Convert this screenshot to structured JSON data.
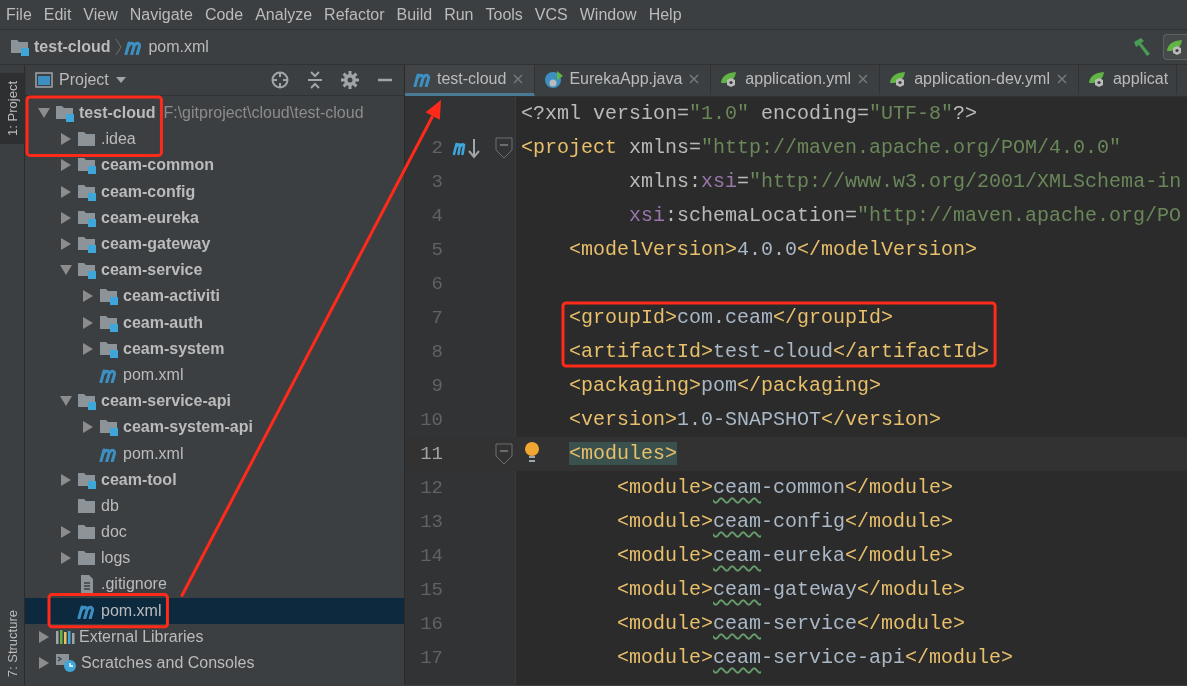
{
  "menu": [
    "File",
    "Edit",
    "View",
    "Navigate",
    "Code",
    "Analyze",
    "Refactor",
    "Build",
    "Run",
    "Tools",
    "VCS",
    "Window",
    "Help"
  ],
  "breadcrumb": [
    {
      "label": "test-cloud",
      "kind": "module",
      "bold": true
    },
    {
      "label": "pom.xml",
      "kind": "maven",
      "bold": false
    }
  ],
  "side_tabs": [
    {
      "label": "1: Project",
      "selected": true
    },
    {
      "label": "7: Structure",
      "selected": false
    }
  ],
  "project_panel": {
    "title": "Project",
    "tree": [
      {
        "label": "test-cloud",
        "hint": "F:\\gitproject\\cloud\\test-cloud",
        "kind": "module",
        "bold": true,
        "expanded": true,
        "selected": false,
        "boxed": true,
        "children": [
          {
            "label": ".idea",
            "kind": "folder",
            "bold": false,
            "expanded": false,
            "selected": false,
            "boxed": true
          },
          {
            "label": "ceam-common",
            "kind": "module",
            "bold": true,
            "expanded": false,
            "selected": false,
            "boxed": false
          },
          {
            "label": "ceam-config",
            "kind": "module",
            "bold": true,
            "expanded": false,
            "selected": false,
            "boxed": false
          },
          {
            "label": "ceam-eureka",
            "kind": "module",
            "bold": true,
            "expanded": false,
            "selected": false,
            "boxed": false
          },
          {
            "label": "ceam-gateway",
            "kind": "module",
            "bold": true,
            "expanded": false,
            "selected": false,
            "boxed": false
          },
          {
            "label": "ceam-service",
            "kind": "module",
            "bold": true,
            "expanded": true,
            "selected": false,
            "boxed": false,
            "children": [
              {
                "label": "ceam-activiti",
                "kind": "module",
                "bold": true,
                "expanded": false,
                "selected": false,
                "boxed": false
              },
              {
                "label": "ceam-auth",
                "kind": "module",
                "bold": true,
                "expanded": false,
                "selected": false,
                "boxed": false
              },
              {
                "label": "ceam-system",
                "kind": "module",
                "bold": true,
                "expanded": false,
                "selected": false,
                "boxed": false
              },
              {
                "label": "pom.xml",
                "kind": "maven",
                "bold": false,
                "selected": false,
                "boxed": false
              }
            ]
          },
          {
            "label": "ceam-service-api",
            "kind": "module",
            "bold": true,
            "expanded": true,
            "selected": false,
            "boxed": false,
            "children": [
              {
                "label": "ceam-system-api",
                "kind": "module",
                "bold": true,
                "expanded": false,
                "selected": false,
                "boxed": false
              },
              {
                "label": "pom.xml",
                "kind": "maven",
                "bold": false,
                "selected": false,
                "boxed": false
              }
            ]
          },
          {
            "label": "ceam-tool",
            "kind": "module",
            "bold": true,
            "expanded": false,
            "selected": false,
            "boxed": false
          },
          {
            "label": "db",
            "kind": "folder",
            "bold": false,
            "selected": false,
            "boxed": false
          },
          {
            "label": "doc",
            "kind": "folder",
            "bold": false,
            "expanded": false,
            "selected": false,
            "boxed": false
          },
          {
            "label": "logs",
            "kind": "folder",
            "bold": false,
            "expanded": false,
            "selected": false,
            "boxed": false
          },
          {
            "label": ".gitignore",
            "kind": "file",
            "bold": false,
            "selected": false,
            "boxed": false
          },
          {
            "label": "pom.xml",
            "kind": "maven",
            "bold": false,
            "selected": true,
            "boxed": true
          }
        ]
      },
      {
        "label": "External Libraries",
        "kind": "libraries",
        "bold": false,
        "expanded": false,
        "selected": false,
        "boxed": false
      },
      {
        "label": "Scratches and Consoles",
        "kind": "scratches",
        "bold": false,
        "expanded": false,
        "selected": false,
        "boxed": false
      }
    ]
  },
  "editor": {
    "tabs": [
      {
        "label": "test-cloud",
        "kind": "maven",
        "selected": true,
        "closable": true,
        "arrow_to": true
      },
      {
        "label": "EurekaApp.java",
        "kind": "class",
        "selected": false,
        "closable": true,
        "arrow_to": false
      },
      {
        "label": "application.yml",
        "kind": "spring",
        "selected": false,
        "closable": true,
        "arrow_to": false
      },
      {
        "label": "application-dev.yml",
        "kind": "spring",
        "selected": false,
        "closable": true,
        "arrow_to": false
      },
      {
        "label": "applicat",
        "kind": "spring",
        "selected": false,
        "closable": false,
        "arrow_to": false
      }
    ],
    "lines": [
      {
        "current": false,
        "boxed": false,
        "tokens": [
          {
            "kind": "plain",
            "text": "<?xml version="
          },
          {
            "kind": "string",
            "text": "\"1.0\""
          },
          {
            "kind": "plain",
            "text": " encoding="
          },
          {
            "kind": "string",
            "text": "\"UTF-8\""
          },
          {
            "kind": "plain",
            "text": "?>"
          }
        ]
      },
      {
        "number": "2",
        "kind": "maven",
        "fold": true,
        "current": false,
        "boxed": false,
        "tokens": [
          {
            "kind": "tag",
            "text": "<project"
          },
          {
            "kind": "attr",
            "text": " xmlns="
          },
          {
            "kind": "string",
            "text": "\"http://maven.apache.org/POM/4.0.0\""
          }
        ]
      },
      {
        "number": "3",
        "current": false,
        "boxed": false,
        "tokens": [
          {
            "kind": "attr",
            "text": "         xmlns:"
          },
          {
            "kind": "ns",
            "text": "xsi"
          },
          {
            "kind": "attr",
            "text": "="
          },
          {
            "kind": "string",
            "text": "\"http://www.w3.org/2001/XMLSchema-in"
          }
        ]
      },
      {
        "number": "4",
        "current": false,
        "boxed": false,
        "tokens": [
          {
            "kind": "ns",
            "text": "         xsi"
          },
          {
            "kind": "attr",
            "text": ":schemaLocation="
          },
          {
            "kind": "string",
            "text": "\"http://maven.apache.org/PO"
          }
        ]
      },
      {
        "number": "5",
        "current": false,
        "boxed": false,
        "tokens": [
          {
            "kind": "tag",
            "text": "    <modelVersion>"
          },
          {
            "kind": "text",
            "text": "4.0.0"
          },
          {
            "kind": "tag",
            "text": "</modelVersion>"
          }
        ]
      },
      {
        "number": "6",
        "current": false,
        "boxed": false
      },
      {
        "number": "7",
        "current": false,
        "boxed": true,
        "tokens": [
          {
            "kind": "tag",
            "text": "    <groupId>"
          },
          {
            "kind": "text",
            "text": "com.ceam"
          },
          {
            "kind": "tag",
            "text": "</groupId>"
          }
        ]
      },
      {
        "number": "8",
        "current": false,
        "boxed": true,
        "tokens": [
          {
            "kind": "tag",
            "text": "    <artifactId>"
          },
          {
            "kind": "text",
            "text": "test-cloud"
          },
          {
            "kind": "tag",
            "text": "</artifactId>"
          }
        ]
      },
      {
        "number": "9",
        "current": false,
        "boxed": false,
        "tokens": [
          {
            "kind": "tag",
            "text": "    <packaging>"
          },
          {
            "kind": "text",
            "text": "pom"
          },
          {
            "kind": "tag",
            "text": "</packaging>"
          }
        ]
      },
      {
        "number": "10",
        "current": false,
        "boxed": false,
        "tokens": [
          {
            "kind": "tag",
            "text": "    <version>"
          },
          {
            "kind": "text",
            "text": "1.0-SNAPSHOT"
          },
          {
            "kind": "tag",
            "text": "</version>"
          }
        ]
      },
      {
        "number": "11",
        "kind": "bulb",
        "fold": true,
        "current": true,
        "boxed": false,
        "tokens": [
          {
            "kind": "tag_match",
            "text": "    <modules>"
          }
        ]
      },
      {
        "number": "12",
        "current": false,
        "boxed": false,
        "tokens": [
          {
            "kind": "tag",
            "text": "        <module>"
          },
          {
            "kind": "typo",
            "text": "ceam"
          },
          {
            "kind": "text",
            "text": "-common"
          },
          {
            "kind": "tag",
            "text": "</module>"
          }
        ]
      },
      {
        "number": "13",
        "current": false,
        "boxed": false,
        "tokens": [
          {
            "kind": "tag",
            "text": "        <module>"
          },
          {
            "kind": "typo",
            "text": "ceam"
          },
          {
            "kind": "text",
            "text": "-config"
          },
          {
            "kind": "tag",
            "text": "</module>"
          }
        ]
      },
      {
        "number": "14",
        "current": false,
        "boxed": false,
        "tokens": [
          {
            "kind": "tag",
            "text": "        <module>"
          },
          {
            "kind": "typo",
            "text": "ceam"
          },
          {
            "kind": "text",
            "text": "-eureka"
          },
          {
            "kind": "tag",
            "text": "</module>"
          }
        ]
      },
      {
        "number": "15",
        "current": false,
        "boxed": false,
        "tokens": [
          {
            "kind": "tag",
            "text": "        <module>"
          },
          {
            "kind": "typo",
            "text": "ceam"
          },
          {
            "kind": "text",
            "text": "-gateway"
          },
          {
            "kind": "tag",
            "text": "</module>"
          }
        ]
      },
      {
        "number": "16",
        "current": false,
        "boxed": false,
        "tokens": [
          {
            "kind": "tag",
            "text": "        <module>"
          },
          {
            "kind": "typo",
            "text": "ceam"
          },
          {
            "kind": "text",
            "text": "-service"
          },
          {
            "kind": "tag",
            "text": "</module>"
          }
        ]
      },
      {
        "number": "17",
        "current": false,
        "boxed": false,
        "tokens": [
          {
            "kind": "tag",
            "text": "        <module>"
          },
          {
            "kind": "typo",
            "text": "ceam"
          },
          {
            "kind": "text",
            "text": "-service-api"
          },
          {
            "kind": "tag",
            "text": "</module>"
          }
        ]
      }
    ]
  }
}
